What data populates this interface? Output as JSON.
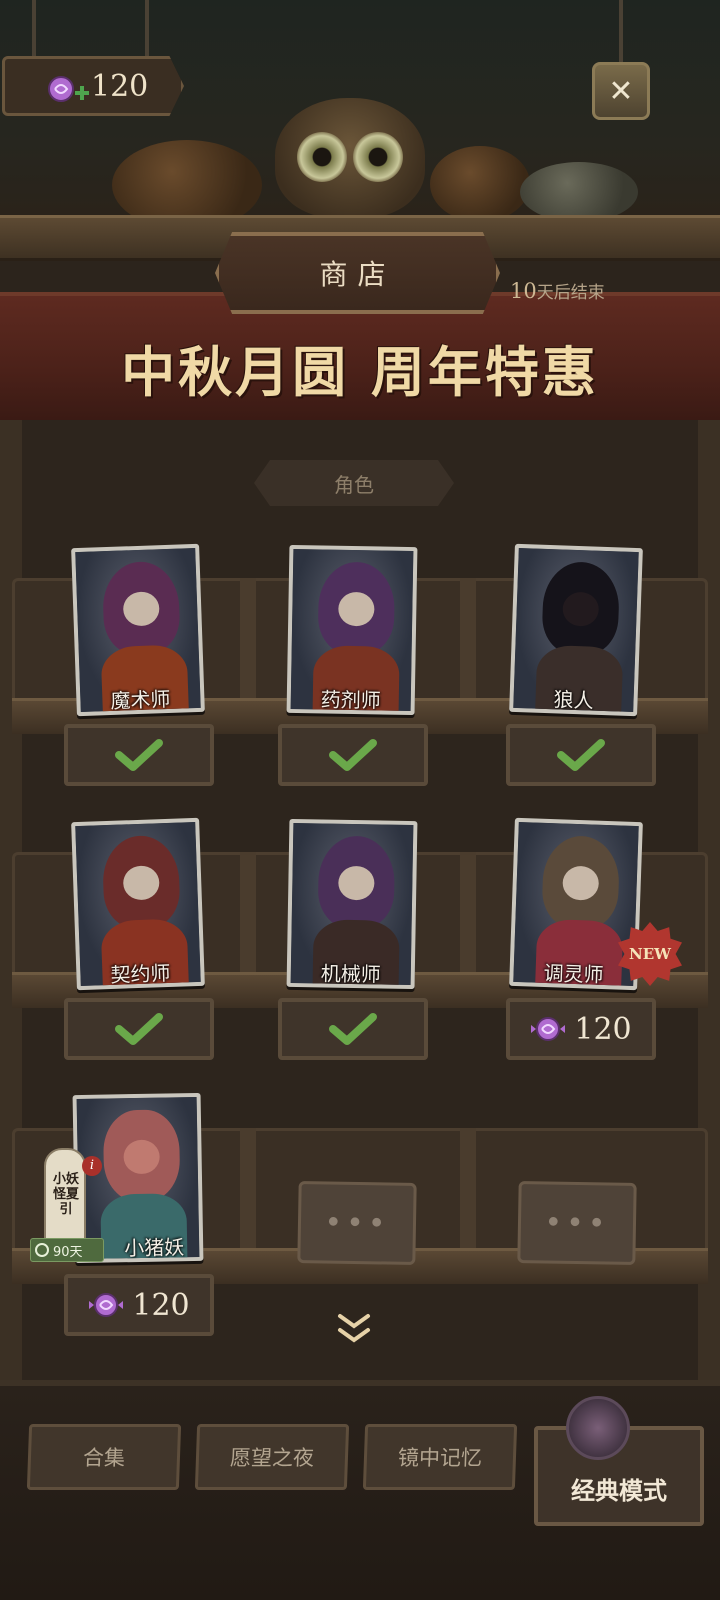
{
  "currency": {
    "amount": "120",
    "icon": "candy-plus-icon"
  },
  "close": {
    "icon": "close-icon",
    "glyph": "✕"
  },
  "shop": {
    "title": "商店",
    "end_days_num": "10",
    "end_days_suffix": "天后结束",
    "banner_title": "中秋月圆  周年特惠",
    "category": "角色"
  },
  "characters": [
    {
      "name": "魔术师",
      "status": "owned",
      "status_icon": "check-icon"
    },
    {
      "name": "药剂师",
      "status": "owned",
      "status_icon": "check-icon"
    },
    {
      "name": "狼人",
      "status": "owned",
      "status_icon": "check-icon"
    },
    {
      "name": "契约师",
      "status": "owned",
      "status_icon": "check-icon"
    },
    {
      "name": "机械师",
      "status": "owned",
      "status_icon": "check-icon"
    },
    {
      "name": "调灵师",
      "status": "price",
      "price": "120",
      "badge": "NEW"
    },
    {
      "name": "小猪妖",
      "status": "price",
      "price": "120",
      "limited_tag": "小妖怪夏引",
      "days": "90天",
      "info": "i"
    }
  ],
  "empty_slots": [
    "•••",
    "•••"
  ],
  "colors": {
    "check": "#6aa84a",
    "candy": "#b06bd0",
    "banner": "#5e2a20",
    "new_badge": "#b1362f"
  },
  "bottom_nav": {
    "collection": "合集",
    "wish_night": "愿望之夜",
    "mirror_memory": "镜中记忆",
    "classic_mode": "经典模式"
  }
}
